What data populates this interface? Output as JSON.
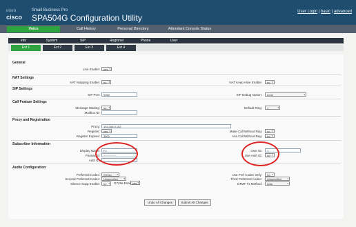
{
  "header": {
    "logo": "cisco",
    "small_business": "Small Business Pro",
    "title": "SPA504G Configuration Utility",
    "links": [
      "User Login",
      "basic",
      "advanced"
    ]
  },
  "nav": {
    "top_tabs": [
      "Voice",
      "Call History",
      "Personal Directory",
      "Attendant Console Status"
    ],
    "sub_tabs": [
      "Info",
      "System",
      "SIP",
      "Regional",
      "Phone",
      "User"
    ],
    "ext_tabs": [
      "Ext 1",
      "Ext 2",
      "Ext 3",
      "Ext 4"
    ]
  },
  "sections": {
    "general": "General",
    "nat": "NAT Settings",
    "sip": "SIP Settings",
    "call_feature": "Call Feature Settings",
    "proxy": "Proxy and Registration",
    "subscriber": "Subscriber Information",
    "audio": "Audio Configuration"
  },
  "fields": {
    "line_enable": {
      "label": "Line Enable:",
      "value": "yes"
    },
    "nat_mapping": {
      "label": "NAT Mapping Enable:",
      "value": "no"
    },
    "nat_keep_alive": {
      "label": "NAT Keep Alive Enable:",
      "value": "no"
    },
    "sip_port": {
      "label": "SIP Port:",
      "value": "5060"
    },
    "sip_debug": {
      "label": "SIP Debug Option:",
      "value": "none"
    },
    "message_waiting": {
      "label": "Message Waiting:",
      "value": "no"
    },
    "default_ring": {
      "label": "Default Ring:",
      "value": "1"
    },
    "mailbox_id": {
      "label": "Mailbox ID:",
      "value": ""
    },
    "proxy": {
      "label": "Proxy:",
      "value": "192.168.0.152"
    },
    "register": {
      "label": "Register:",
      "value": "yes"
    },
    "register_expires": {
      "label": "Register Expires:",
      "value": "3600"
    },
    "make_call_wo_reg": {
      "label": "Make Call Without Reg:",
      "value": "no"
    },
    "ans_call_wo_reg": {
      "label": "Ans Call Without Reg:",
      "value": "no"
    },
    "display_name": {
      "label": "Display Name:",
      "value": "FJ"
    },
    "password": {
      "label": "Password:",
      "value": "************"
    },
    "auth_id": {
      "label": "Auth ID:",
      "value": ""
    },
    "user_id": {
      "label": "User ID:",
      "value": "1"
    },
    "use_auth_id": {
      "label": "Use Auth ID:",
      "value": "no"
    },
    "preferred_codec": {
      "label": "Preferred Codec:",
      "value": "G711u"
    },
    "second_codec": {
      "label": "Second Preferred Codec:",
      "value": "Unspecified"
    },
    "g729a_enable": {
      "label": "G729a Enable:",
      "value": "yes"
    },
    "silence_supp": {
      "label": "Silence Supp Enable:",
      "value": "no"
    },
    "use_pref_codec_only": {
      "label": "Use Pref Codec Only:",
      "value": "no"
    },
    "third_codec": {
      "label": "Third Preferred Codec:",
      "value": "Unspecified"
    },
    "dtmf_tx_method": {
      "label": "DTMF Tx Method:",
      "value": "Auto"
    }
  },
  "buttons": {
    "undo": "Undo All Changes",
    "submit": "Submit All Changes"
  }
}
